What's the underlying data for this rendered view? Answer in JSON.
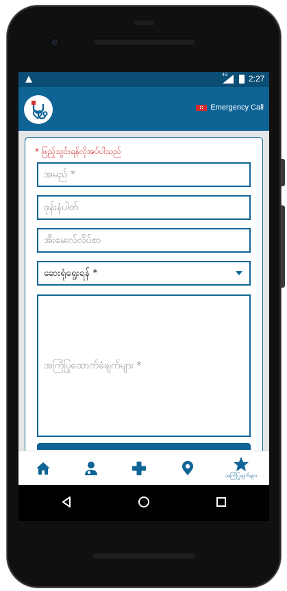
{
  "status_bar": {
    "network_type": "4G",
    "time": "2:27",
    "icons": [
      "warning-icon",
      "signal-icon",
      "battery-icon"
    ]
  },
  "app_bar": {
    "logo_icon": "stethoscope-heart-logo",
    "emergency_label": "Emergency Call",
    "emergency_icon": "ambulance-icon"
  },
  "form": {
    "required_note": "* ဖြည့်သွင်းရန်လိုအပ်ပါသည်",
    "name_placeholder": "အမည် *",
    "phone_placeholder": "ဖုန်းနံပါတ်",
    "email_placeholder": "အီးမေးလ်လိပ်စာ",
    "hospital_select_value": "ဆေးရုံရွေးရန် *",
    "message_placeholder": "အကြံပြုထောက်ခံချက်များ *"
  },
  "bottom_nav": {
    "items": [
      {
        "icon": "home-icon"
      },
      {
        "icon": "doctor-icon"
      },
      {
        "icon": "plus-icon"
      },
      {
        "icon": "location-pin-icon"
      },
      {
        "icon": "star-icon",
        "label": "အကြံပြုချက်များ"
      }
    ]
  },
  "system_nav": {
    "icons": [
      "back-icon",
      "home-circle-icon",
      "recents-icon"
    ]
  },
  "colors": {
    "primary": "#0f6496",
    "status_bar": "#0b4d74",
    "required_red": "#d32f2f",
    "background": "#e4e6e8"
  }
}
